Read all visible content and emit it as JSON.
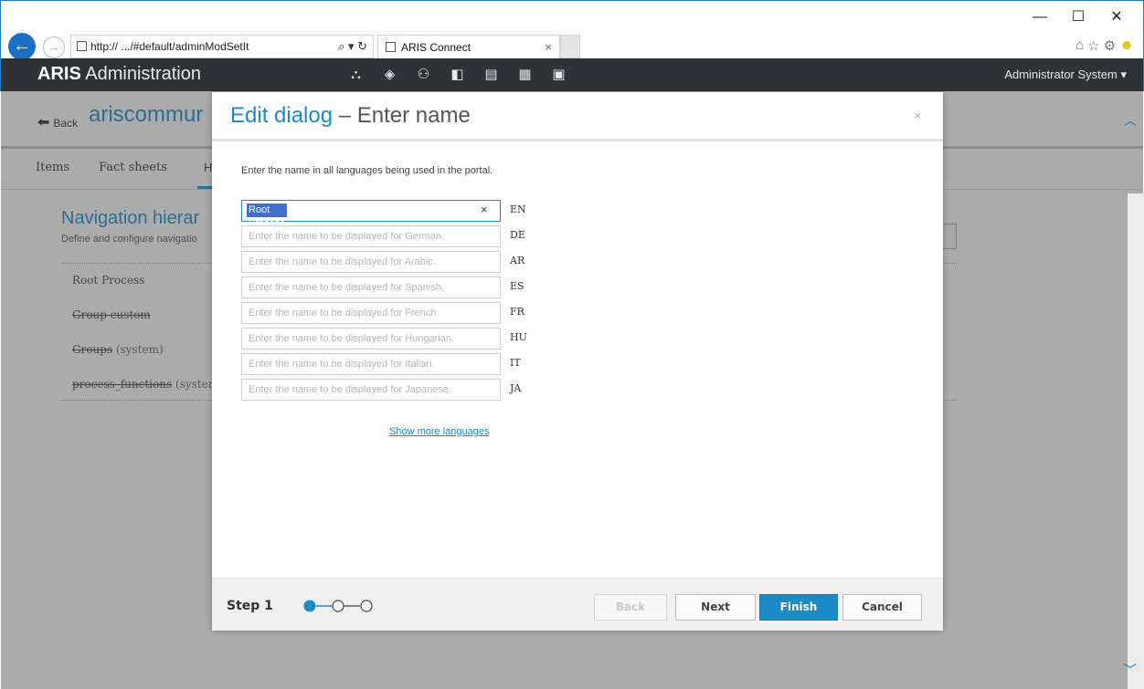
{
  "browser": {
    "address": "http://        .../#default/adminModSetIt",
    "address_controls": "⌕ ▾ ↻",
    "tab_title": "ARIS Connect",
    "tab_close": "×",
    "window_controls": [
      "—",
      "☐",
      "✕"
    ],
    "back_icon": "back-arrow-icon",
    "forward_icon": "forward-arrow-icon"
  },
  "app": {
    "brand": "ARIS",
    "title": "Administration",
    "user": "Administrator System",
    "toolbar_icons": [
      "hierarchy-icon",
      "cube-icon",
      "users-icon",
      "database-icon",
      "document-icon",
      "grid-icon",
      "monitor-icon"
    ]
  },
  "background": {
    "back_label": "Back",
    "title": "ariscommur",
    "tabs": [
      "Items",
      "Fact sheets"
    ],
    "active_tab_letter": "H",
    "heading": "Navigation hierar",
    "description": "Define and configure navigatio",
    "list": [
      {
        "name": "Root Process",
        "suffix": "",
        "strike": false
      },
      {
        "name": "Group custom",
        "suffix": "",
        "strike": true
      },
      {
        "name": "Groups",
        "suffix": " (system)",
        "strike": true
      },
      {
        "name": "process_functions",
        "suffix": " (system)",
        "strike": true
      }
    ]
  },
  "dialog": {
    "title": "Edit dialog",
    "title_sep": " – ",
    "subtitle": "Enter name",
    "close": "×",
    "intro": "Enter the name in all languages being used in the portal.",
    "fields": [
      {
        "lang": "EN",
        "value": "Root Process",
        "placeholder": ""
      },
      {
        "lang": "DE",
        "value": "",
        "placeholder": "Enter the name to be displayed for German."
      },
      {
        "lang": "AR",
        "value": "",
        "placeholder": "Enter the name to be displayed for Arabic."
      },
      {
        "lang": "ES",
        "value": "",
        "placeholder": "Enter the name to be displayed for Spanish."
      },
      {
        "lang": "FR",
        "value": "",
        "placeholder": "Enter the name to be displayed for French."
      },
      {
        "lang": "HU",
        "value": "",
        "placeholder": "Enter the name to be displayed for Hungarian."
      },
      {
        "lang": "IT",
        "value": "",
        "placeholder": "Enter the name to be displayed for Italian."
      },
      {
        "lang": "JA",
        "value": "",
        "placeholder": "Enter the name to be displayed for Japanese."
      }
    ],
    "more_languages": "Show more languages",
    "step_label": "Step 1",
    "step_current": 1,
    "step_total": 3,
    "buttons": {
      "back": "Back",
      "next": "Next",
      "finish": "Finish",
      "cancel": "Cancel"
    },
    "accent": "#1d8ac7"
  }
}
